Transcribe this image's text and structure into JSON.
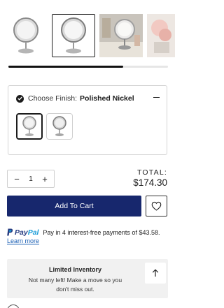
{
  "gallery": {
    "thumbnails": [
      {
        "icon": "mirror-product-icon"
      },
      {
        "icon": "mirror-product-icon"
      },
      {
        "icon": "mirror-lifestyle-photo"
      },
      {
        "icon": "mirror-lifestyle-photo"
      }
    ],
    "selected_index": 1,
    "scroll_fraction": 0.72
  },
  "finish": {
    "label": "Choose Finish:",
    "value": "Polished Nickel",
    "options": [
      {
        "icon": "polished-nickel-swatch",
        "selected": true
      },
      {
        "icon": "alternate-finish-swatch",
        "selected": false
      }
    ]
  },
  "quantity": {
    "minus": "−",
    "value": "1",
    "plus": "+"
  },
  "total": {
    "label": "TOTAL:",
    "value": "$174.30"
  },
  "cart": {
    "add_label": "Add To Cart",
    "wishlist_icon": "heart-icon",
    "accent": "#17276d"
  },
  "paypal": {
    "logo_pay": "Pay",
    "logo_pal": "Pal",
    "message": "Pay in 4 interest-free payments of $43.58.",
    "learn_more": "Learn more"
  },
  "inventory": {
    "title": "Limited Inventory",
    "message": "Not many left! Make a move so you don't miss out.",
    "scroll_top_icon": "arrow-up-icon"
  }
}
